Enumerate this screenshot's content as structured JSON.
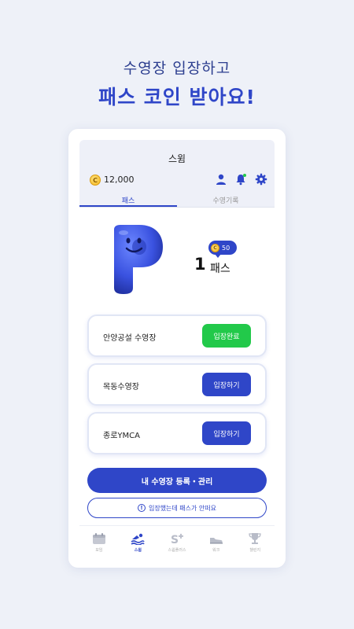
{
  "promo": {
    "subtitle": "수영장 입장하고",
    "title": "패스 코인 받아요!"
  },
  "app": {
    "title": "스윔",
    "coin_balance": "12,000",
    "coin_symbol": "C"
  },
  "tabs": [
    {
      "label": "패스",
      "active": true
    },
    {
      "label": "수영기록",
      "active": false
    }
  ],
  "pass": {
    "reward_coins": "50",
    "count": "1",
    "unit": "패스"
  },
  "pools": [
    {
      "name": "안양공설 수영장",
      "button": "입장완료",
      "status": "done"
    },
    {
      "name": "목동수영장",
      "button": "입장하기",
      "status": "enter"
    },
    {
      "name": "종로YMCA",
      "button": "입장하기",
      "status": "enter"
    }
  ],
  "actions": {
    "manage_label": "내 수영장 등록・관리",
    "help_label": "입장했는데 패스가 안떠요"
  },
  "nav": [
    {
      "label": "모임",
      "icon": "calendar-icon",
      "active": false
    },
    {
      "label": "스윔",
      "icon": "swimmer-icon",
      "active": true
    },
    {
      "label": "스윔플러스",
      "icon": "s-plus-icon",
      "active": false
    },
    {
      "label": "워크",
      "icon": "shoe-icon",
      "active": false
    },
    {
      "label": "챌린지",
      "icon": "trophy-icon",
      "active": false
    }
  ],
  "colors": {
    "brand_blue": "#2f46c8",
    "done_green": "#22c94a",
    "background": "#eef1f8"
  }
}
